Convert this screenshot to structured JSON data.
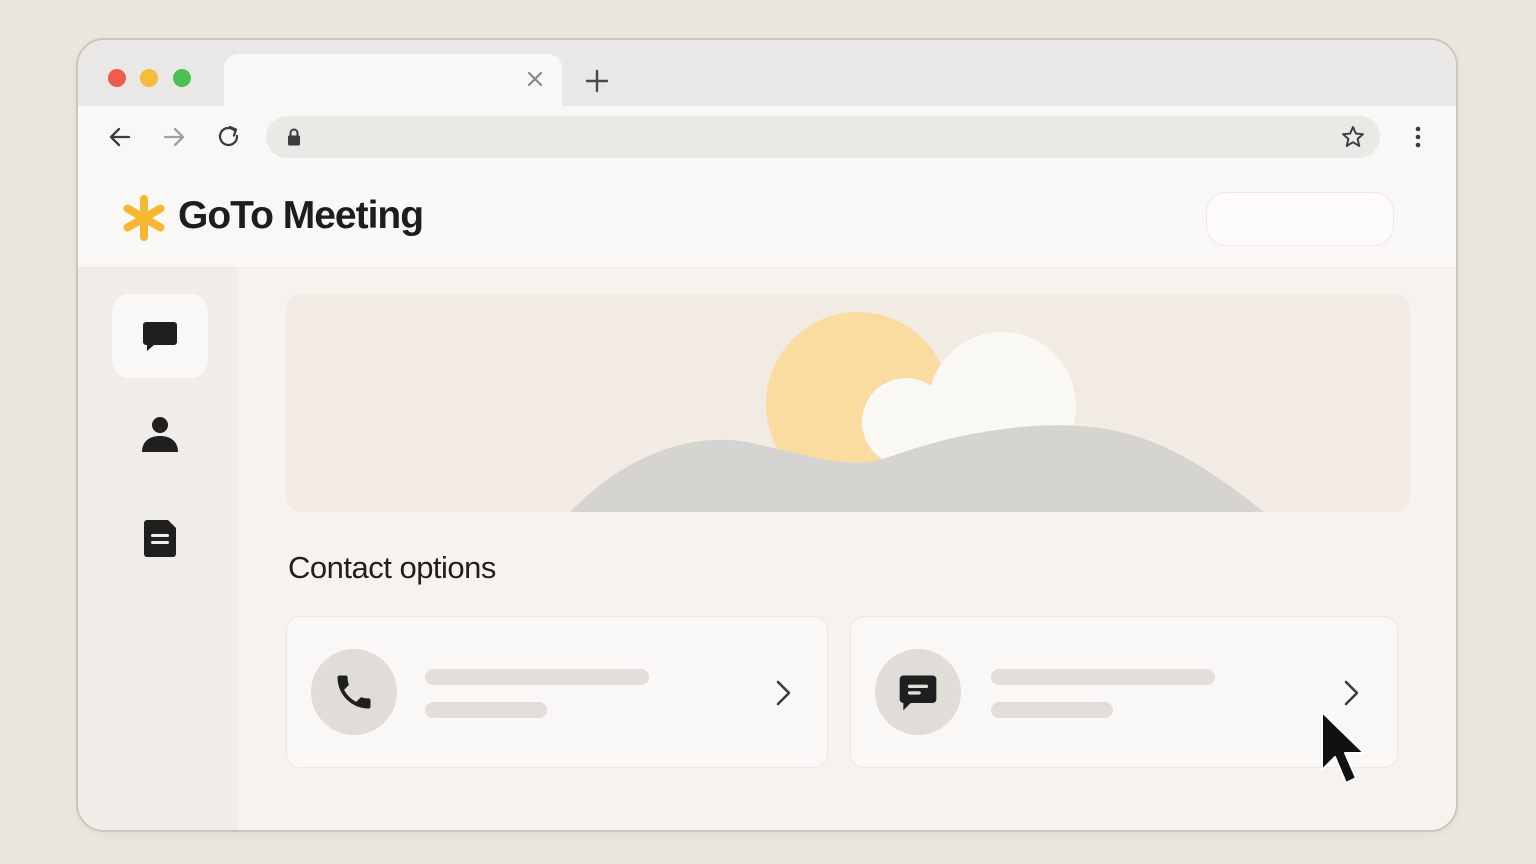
{
  "browser": {
    "tab": {
      "title": "",
      "close_icon": "close-icon"
    },
    "new_tab_icon": "plus-icon",
    "nav": {
      "back_icon": "arrow-left-icon",
      "forward_icon": "arrow-right-icon",
      "reload_icon": "reload-icon"
    },
    "address": {
      "url": "",
      "lock_icon": "lock-icon",
      "bookmark_icon": "star-icon"
    },
    "menu_icon": "kebab-menu-icon",
    "traffic_lights": {
      "close": "#ee5b4f",
      "minimize": "#f6bc3c",
      "maximize": "#4dbf55"
    }
  },
  "app": {
    "brand": "GoTo Meeting",
    "brand_color": "#f7b733",
    "header_button_label": ""
  },
  "sidebar": {
    "items": [
      {
        "icon": "chat-bubble-icon",
        "active": true
      },
      {
        "icon": "person-icon",
        "active": false
      },
      {
        "icon": "document-icon",
        "active": false
      }
    ]
  },
  "main": {
    "section_title": "Contact options",
    "cards": [
      {
        "icon": "phone-icon",
        "title": "",
        "subtitle": ""
      },
      {
        "icon": "message-icon",
        "title": "",
        "subtitle": ""
      }
    ]
  },
  "cursor_icon": "mouse-pointer-icon"
}
